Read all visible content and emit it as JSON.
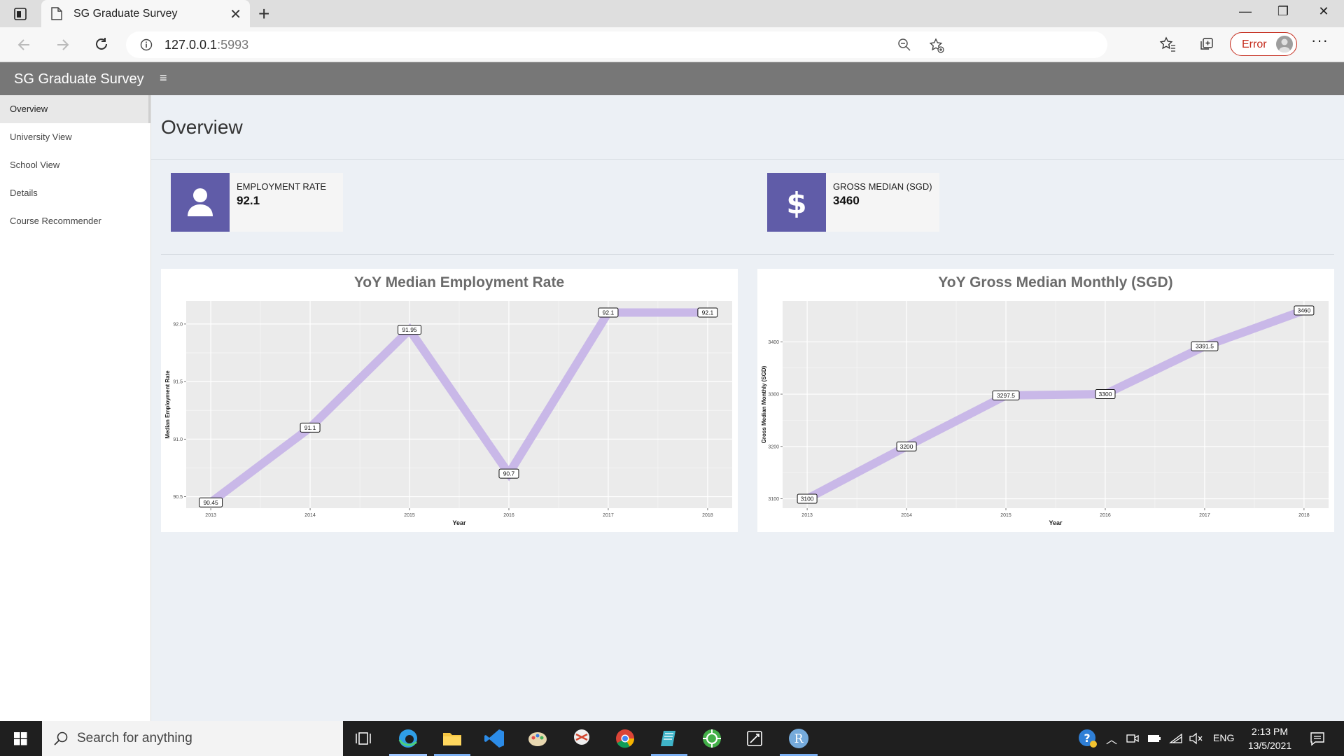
{
  "browser": {
    "tab_title": "SG Graduate Survey",
    "url_host": "127.0.0.1",
    "url_port": ":5993",
    "error_label": "Error"
  },
  "app": {
    "brand": "SG Graduate Survey",
    "menu_toggle": "≡"
  },
  "sidebar": {
    "items": [
      {
        "label": "Overview",
        "active": true
      },
      {
        "label": "University View",
        "active": false
      },
      {
        "label": "School View",
        "active": false
      },
      {
        "label": "Details",
        "active": false
      },
      {
        "label": "Course Recommender",
        "active": false
      }
    ]
  },
  "main": {
    "title": "Overview",
    "info_boxes": [
      {
        "label": "EMPLOYMENT RATE",
        "value": "92.1",
        "icon": "user-icon",
        "color": "#605ca8"
      },
      {
        "label": "GROSS MEDIAN (SGD)",
        "value": "3460",
        "icon": "dollar-icon",
        "color": "#605ca8"
      }
    ]
  },
  "chart_data": [
    {
      "type": "line",
      "title": "YoY Median Employment Rate",
      "xlabel": "Year",
      "ylabel": "Median Employment Rate",
      "x": [
        "2013",
        "2014",
        "2015",
        "2016",
        "2017",
        "2018"
      ],
      "values": [
        90.45,
        91.1,
        91.95,
        90.7,
        92.1,
        92.1
      ],
      "labels": [
        "90.45",
        "91.1",
        "91.95",
        "90.7",
        "92.1",
        "92.1"
      ],
      "ylim": [
        90.4,
        92.2
      ],
      "yticks": [
        "90.5",
        "91.0",
        "91.5",
        "92.0"
      ],
      "ytick_values": [
        90.5,
        91.0,
        91.5,
        92.0
      ],
      "line_color": "#c9b8e8",
      "grid": true,
      "legend": "none"
    },
    {
      "type": "line",
      "title": "YoY Gross Median Monthly (SGD)",
      "xlabel": "Year",
      "ylabel": "Gross Median Monthly (SGD)",
      "x": [
        "2013",
        "2014",
        "2015",
        "2016",
        "2017",
        "2018"
      ],
      "values": [
        3100,
        3200,
        3297.5,
        3300,
        3391.5,
        3460
      ],
      "labels": [
        "3100",
        "3200",
        "3297.5",
        "3300",
        "3391.5",
        "3460"
      ],
      "ylim": [
        3082,
        3478
      ],
      "yticks": [
        "3100",
        "3200",
        "3300",
        "3400"
      ],
      "ytick_values": [
        3100,
        3200,
        3300,
        3400
      ],
      "line_color": "#c9b8e8",
      "grid": true,
      "legend": "none"
    }
  ],
  "taskbar": {
    "search_placeholder": "Search for anything",
    "language": "ENG",
    "time": "2:13 PM",
    "date": "13/5/2021"
  }
}
